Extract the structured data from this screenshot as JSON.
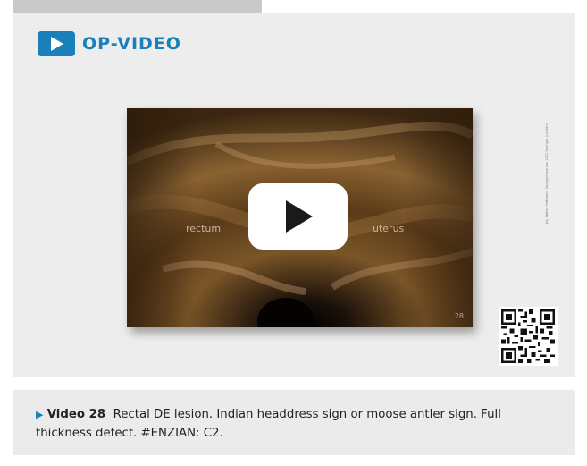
{
  "header": {
    "title": "OP-VIDEO",
    "accent_color": "#1a80b9",
    "icon": "play-icon"
  },
  "video": {
    "label_left": "rectum",
    "label_right": "uterus",
    "corner_number": "28",
    "play_icon": "play-icon",
    "copyright": "(Ig. Walter Hoffmann, Stuttgart aus u.a. 2022 Springer. Juchtern)"
  },
  "qr": {
    "icon": "qr-code-icon"
  },
  "caption": {
    "marker": "▶",
    "video_label": "Video 28",
    "text": "Rectal DE lesion. Indian headdress sign or moose antler sign. Full thickness defect. #ENZIAN: C2."
  }
}
